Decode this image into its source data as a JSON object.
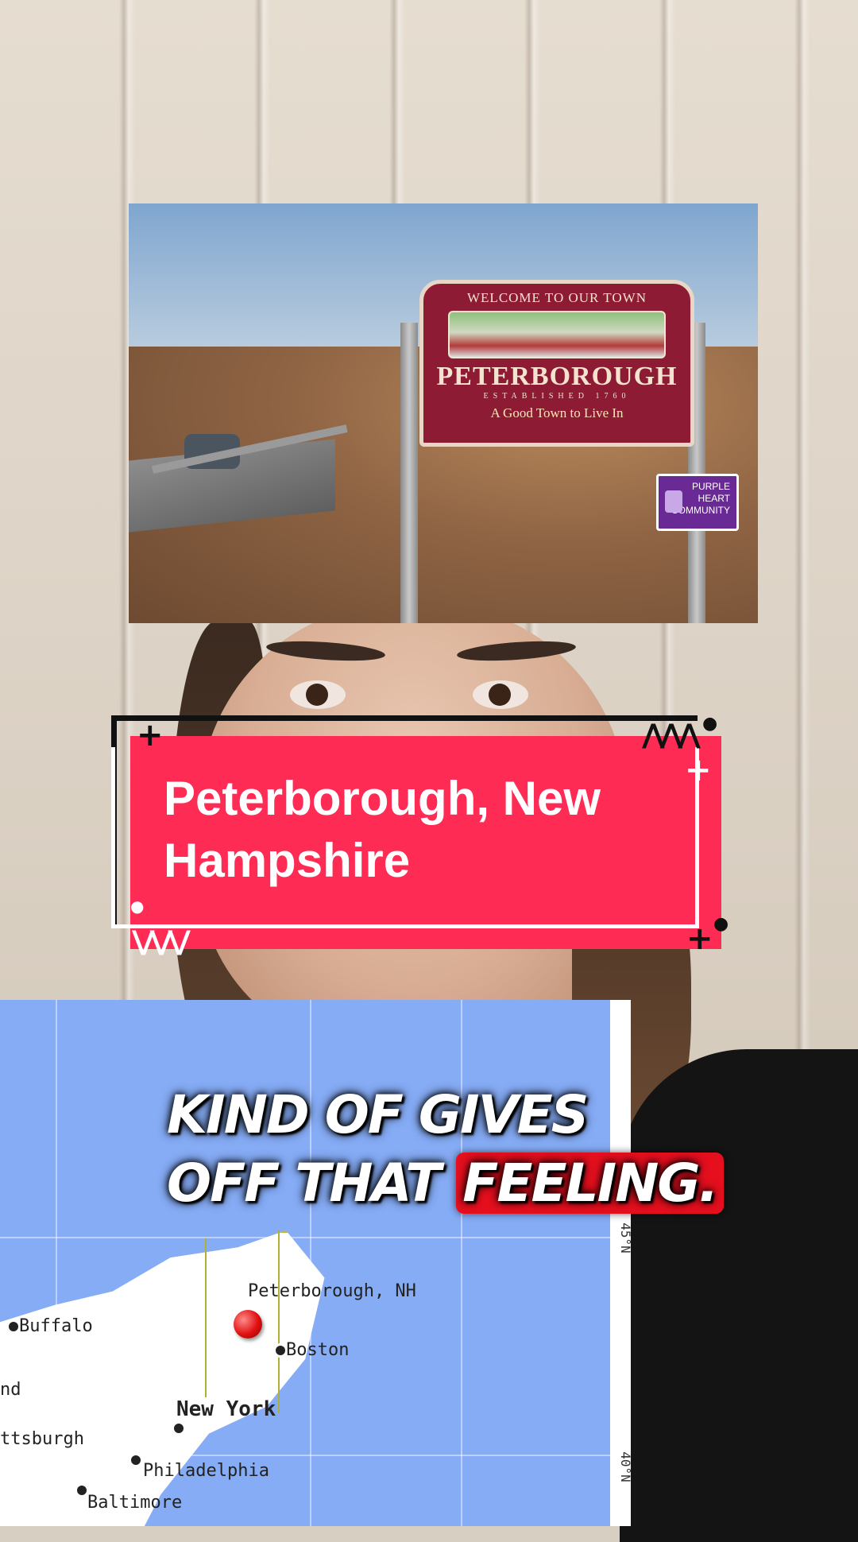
{
  "photo": {
    "sign_welcome": "WELCOME TO OUR TOWN",
    "sign_town": "PETERBOROUGH",
    "sign_established": "ESTABLISHED 1760",
    "sign_tagline": "A Good Town to Live In",
    "badge_text": "PURPLE HEART COMMUNITY"
  },
  "location_card": {
    "title": "Peterborough, New Hampshire",
    "accent_color": "#fe2c55"
  },
  "map": {
    "marker_label": "Peterborough, NH",
    "cities": [
      "Buffalo",
      "Boston",
      "New York",
      "Philadelphia",
      "Baltimore"
    ],
    "partial_labels": [
      "nd",
      "ttsburgh"
    ],
    "lat_labels": [
      "45°N",
      "40°N"
    ],
    "marker_color": "#e01010"
  },
  "caption": {
    "line1": "KIND OF GIVES",
    "line2_plain": "OFF THAT",
    "line2_highlight": "FEELING.",
    "highlight_color": "#e60f1e"
  }
}
